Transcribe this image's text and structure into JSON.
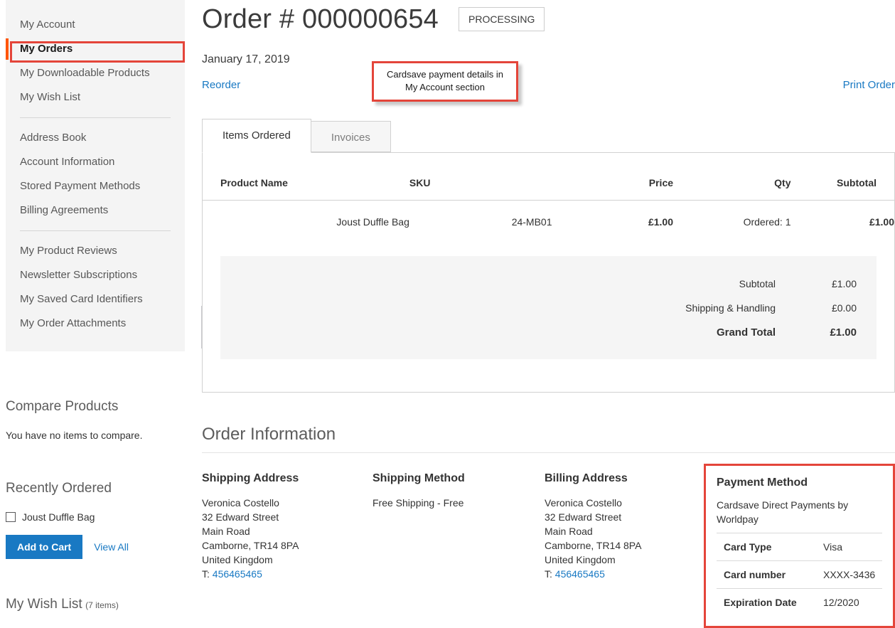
{
  "sidebar": {
    "nav": {
      "groups": [
        {
          "items": [
            {
              "label": "My Account",
              "current": false
            },
            {
              "label": "My Orders",
              "current": true
            },
            {
              "label": "My Downloadable Products",
              "current": false
            },
            {
              "label": "My Wish List",
              "current": false
            }
          ]
        },
        {
          "items": [
            {
              "label": "Address Book",
              "current": false
            },
            {
              "label": "Account Information",
              "current": false
            },
            {
              "label": "Stored Payment Methods",
              "current": false
            },
            {
              "label": "Billing Agreements",
              "current": false
            }
          ]
        },
        {
          "items": [
            {
              "label": "My Product Reviews",
              "current": false
            },
            {
              "label": "Newsletter Subscriptions",
              "current": false
            },
            {
              "label": "My Saved Card Identifiers",
              "current": false
            },
            {
              "label": "My Order Attachments",
              "current": false
            }
          ]
        }
      ]
    },
    "compare": {
      "title": "Compare Products",
      "empty_text": "You have no items to compare."
    },
    "recently_ordered": {
      "title": "Recently Ordered",
      "items": [
        {
          "label": "Joust Duffle Bag",
          "checked": false
        }
      ],
      "add_to_cart_label": "Add to Cart",
      "view_all_label": "View All"
    },
    "wishlist": {
      "title": "My Wish List",
      "count_label": "(7 items)"
    }
  },
  "header": {
    "title": "Order # 000000654",
    "status": "PROCESSING",
    "date": "January 17, 2019",
    "reorder_label": "Reorder",
    "print_label": "Print Order"
  },
  "annotations": {
    "callout_line1": "Cardsave payment details in",
    "callout_line2": "My Account section",
    "highlight_color": "#e4453a"
  },
  "tabs": [
    {
      "label": "Items Ordered",
      "active": true
    },
    {
      "label": "Invoices",
      "active": false
    }
  ],
  "items_table": {
    "columns": [
      "Product Name",
      "SKU",
      "Price",
      "Qty",
      "Subtotal"
    ],
    "rows": [
      {
        "product_name": "Joust Duffle Bag",
        "sku": "24-MB01",
        "price": "£1.00",
        "qty": "Ordered: 1",
        "subtotal": "£1.00"
      }
    ],
    "totals": [
      {
        "label": "Subtotal",
        "value": "£1.00",
        "grand": false
      },
      {
        "label": "Shipping & Handling",
        "value": "£0.00",
        "grand": false
      },
      {
        "label": "Grand Total",
        "value": "£1.00",
        "grand": true
      }
    ]
  },
  "order_information": {
    "title": "Order Information",
    "shipping_address": {
      "heading": "Shipping Address",
      "name": "Veronica Costello",
      "street1": "32 Edward Street",
      "street2": "Main Road",
      "city_postcode": "Camborne, TR14 8PA",
      "country": "United Kingdom",
      "phone_prefix": "T:",
      "phone": "456465465"
    },
    "shipping_method": {
      "heading": "Shipping Method",
      "value": "Free Shipping - Free"
    },
    "billing_address": {
      "heading": "Billing Address",
      "name": "Veronica Costello",
      "street1": "32 Edward Street",
      "street2": "Main Road",
      "city_postcode": "Camborne, TR14 8PA",
      "country": "United Kingdom",
      "phone_prefix": "T:",
      "phone": "456465465"
    },
    "payment_method": {
      "heading": "Payment Method",
      "method_name": "Cardsave Direct Payments by Worldpay",
      "rows": [
        {
          "label": "Card Type",
          "value": "Visa"
        },
        {
          "label": "Card number",
          "value": "XXXX-3436"
        },
        {
          "label": "Expiration Date",
          "value": "12/2020"
        }
      ]
    }
  },
  "colors": {
    "link": "#1979c3",
    "accent_orange": "#ff5501",
    "annotation_red": "#e4453a",
    "panel_gray": "#f4f4f4"
  }
}
